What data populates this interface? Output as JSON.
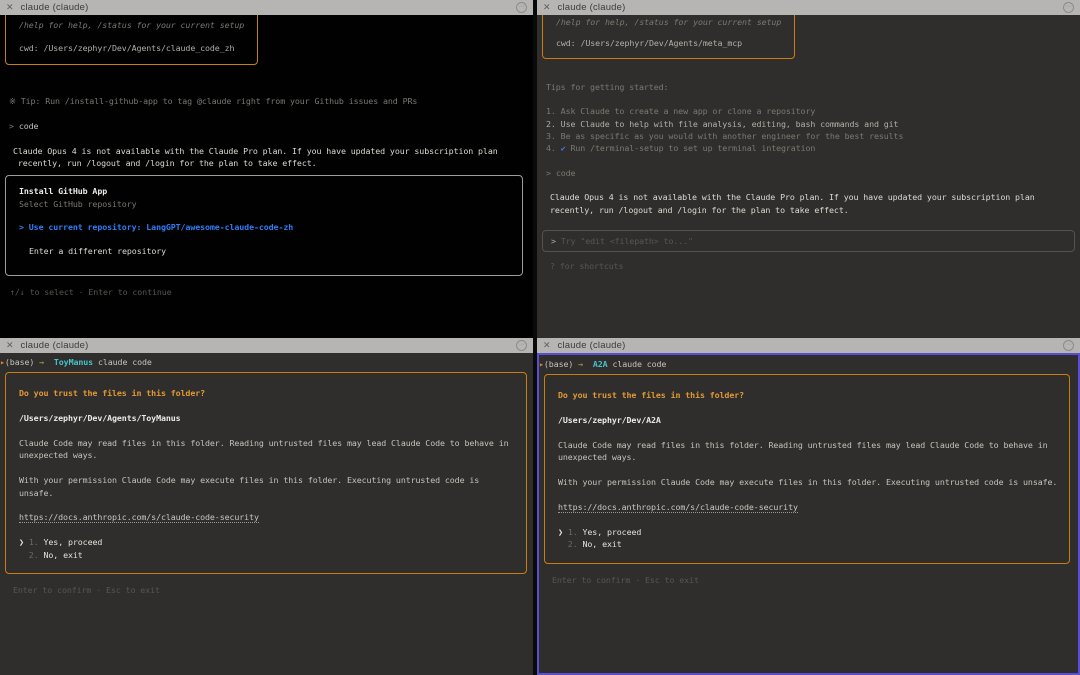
{
  "colors": {
    "accent_orange": "#c97e0e",
    "trust_title_orange": "#e09a35",
    "selection_blue": "#2f7df6",
    "dir_cyan": "#45c3c9",
    "arrow_yellow": "#b3a14b",
    "check_blue": "#3f7fd6",
    "focus_purple": "#5a4fd0",
    "titlebar_gray": "#b6b5b3"
  },
  "windows": {
    "top_left": {
      "titlebar": {
        "close": "✕",
        "title": "claude (claude)"
      },
      "welcome": {
        "help_line": "/help for help, /status for your current setup",
        "cwd_line": "cwd: /Users/zephyr/Dev/Agents/claude_code_zh"
      },
      "tip_line": "※ Tip: Run /install-github-app to tag @claude right from your Github issues and PRs",
      "prompt_caret": ">",
      "prompt_command": "code",
      "plan_notice_line1": "Claude Opus 4 is not available with the Claude Pro plan. If you have updated your subscription plan",
      "plan_notice_line2": " recently, run /logout and /login for the plan to take effect.",
      "github_dialog": {
        "title": "Install GitHub App",
        "subtitle": "Select GitHub repository",
        "selected_option": "> Use current repository: LangGPT/awesome-claude-code-zh",
        "other_option": "Enter a different repository"
      },
      "footer_hint": "↑/↓ to select · Enter to continue"
    },
    "top_right": {
      "titlebar": {
        "close": "✕",
        "title": "claude (claude)"
      },
      "welcome": {
        "help_line": "/help for help, /status for your current setup",
        "cwd_line": "cwd: /Users/zephyr/Dev/Agents/meta_mcp"
      },
      "tips_header": "Tips for getting started:",
      "tip1": "1. Ask Claude to create a new app or clone a repository",
      "tip2": "2. Use Claude to help with file analysis, editing, bash commands and git",
      "tip3": "3. Be as specific as you would with another engineer for the best results",
      "tip4_num": "4.",
      "tip4_check": "✔",
      "tip4_text": "Run /terminal-setup to set up terminal integration",
      "prompt_caret": ">",
      "prompt_command": "code",
      "plan_notice_line1": "Claude Opus 4 is not available with the Claude Pro plan. If you have updated your subscription plan",
      "plan_notice_line2": "recently, run /logout and /login for the plan to take effect.",
      "input_caret": ">",
      "input_placeholder": "Try \"edit <filepath> to...\"",
      "shortcuts_hint": "? for shortcuts"
    },
    "bottom_left": {
      "titlebar": {
        "close": "✕",
        "title": "claude (claude)"
      },
      "shell_prompt": {
        "marker": "▸",
        "env": "(base)",
        "arrow": "→",
        "dir": "ToyManus",
        "command": "claude code"
      },
      "trust_dialog": {
        "title": "Do you trust the files in this folder?",
        "path": "/Users/zephyr/Dev/Agents/ToyManus",
        "para1_line1": "Claude Code may read files in this folder. Reading untrusted files may lead Claude Code to behave in",
        "para1_line2": "unexpected ways.",
        "para2_line1": "With your permission Claude Code may execute files in this folder. Executing untrusted code is",
        "para2_line2": "unsafe.",
        "link": "https://docs.anthropic.com/s/claude-code-security",
        "option1_pointer": "❯",
        "option1_num": "1.",
        "option1_label": "Yes, proceed",
        "option2_num": "2.",
        "option2_label": "No, exit"
      },
      "footer_hint": "Enter to confirm · Esc to exit"
    },
    "bottom_right": {
      "titlebar": {
        "close": "✕",
        "title": "claude (claude)"
      },
      "shell_prompt": {
        "marker": "▸",
        "env": "(base)",
        "arrow": "→",
        "dir": "A2A",
        "command": "claude code"
      },
      "trust_dialog": {
        "title": "Do you trust the files in this folder?",
        "path": "/Users/zephyr/Dev/A2A",
        "para1_line1": "Claude Code may read files in this folder. Reading untrusted files may lead Claude Code to behave in",
        "para1_line2": "unexpected ways.",
        "para2_line1": "With your permission Claude Code may execute files in this folder. Executing untrusted code is unsafe.",
        "link": "https://docs.anthropic.com/s/claude-code-security",
        "option1_pointer": "❯",
        "option1_num": "1.",
        "option1_label": "Yes, proceed",
        "option2_num": "2.",
        "option2_label": "No, exit"
      },
      "footer_hint": "Enter to confirm · Esc to exit"
    }
  }
}
